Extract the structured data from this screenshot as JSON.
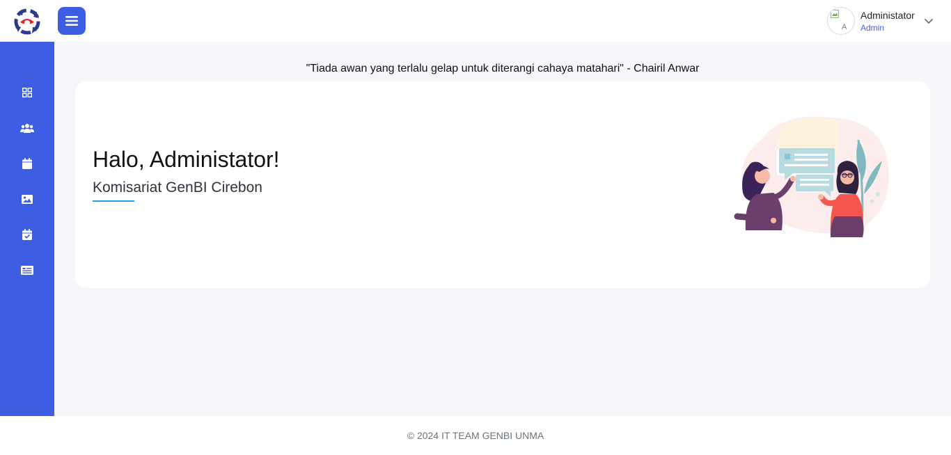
{
  "header": {
    "user": {
      "name": "Administator",
      "role": "Admin",
      "avatar_alt": "A"
    }
  },
  "sidebar": {
    "items": [
      {
        "icon": "dashboard-grid-icon"
      },
      {
        "icon": "users-icon"
      },
      {
        "icon": "calendar-icon"
      },
      {
        "icon": "image-icon"
      },
      {
        "icon": "calendar-check-icon"
      },
      {
        "icon": "news-card-icon"
      }
    ]
  },
  "main": {
    "quote": "\"Tiada awan yang terlalu gelap untuk diterangi cahaya matahari\" - Chairil Anwar",
    "greeting": "Halo, Administator!",
    "subtitle": "Komisariat GenBI Cirebon"
  },
  "footer": {
    "text": "© 2024 IT TEAM GENBI UNMA"
  },
  "colors": {
    "primary": "#3d5ee3",
    "accent_underline": "#1ea1e8",
    "background": "#f5f6f9"
  }
}
